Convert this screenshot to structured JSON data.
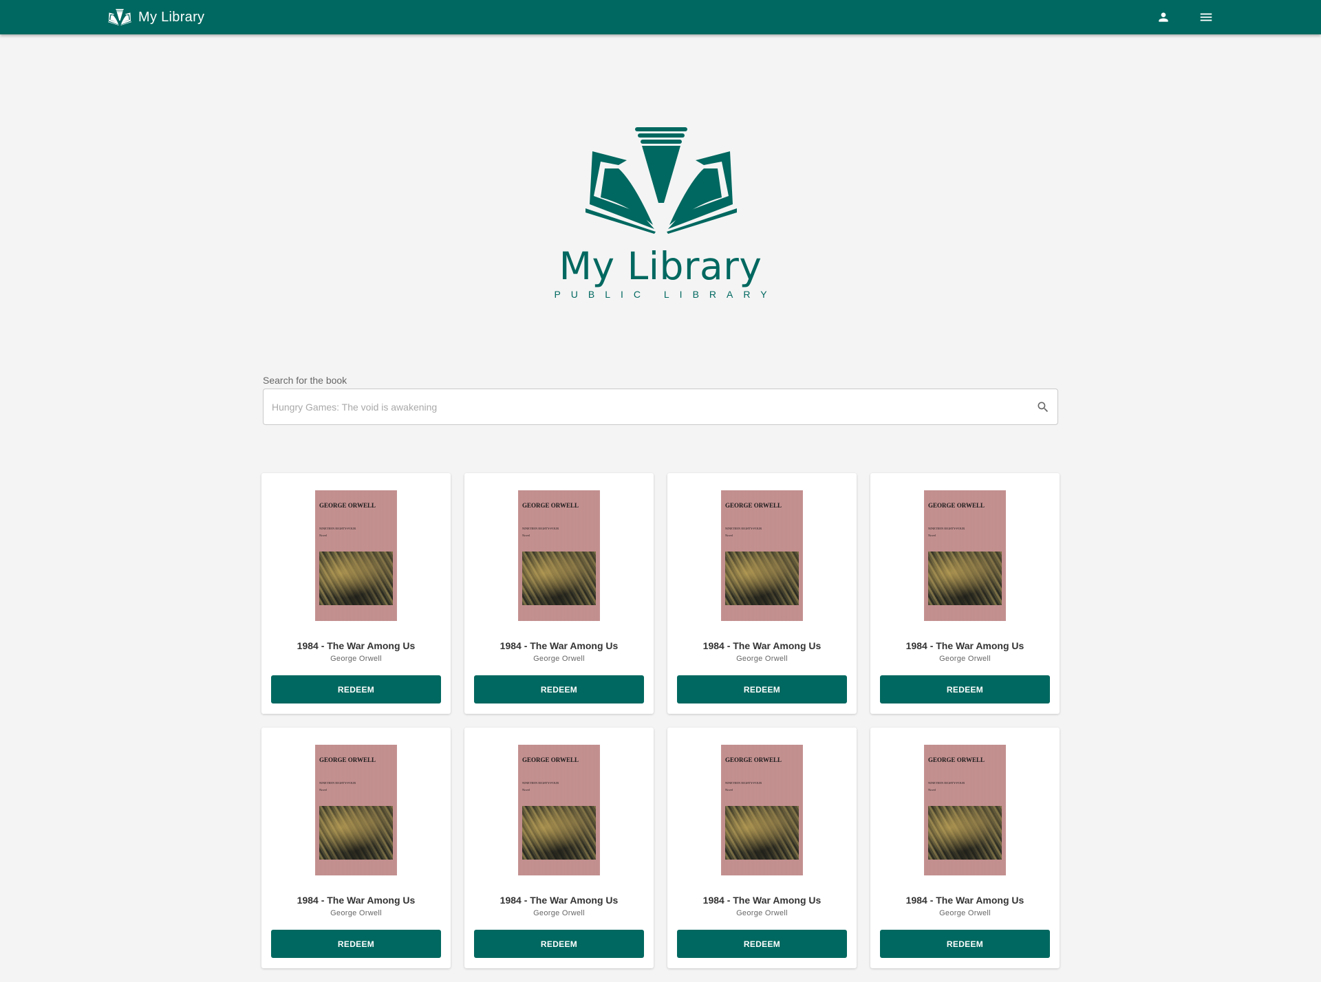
{
  "header": {
    "app_name": "My Library",
    "icons": [
      "book-logo-icon",
      "user-icon",
      "menu-icon"
    ]
  },
  "hero": {
    "title": "My Library",
    "subtitle": "PUBLIC LIBRARY"
  },
  "search": {
    "label": "Search for the book",
    "placeholder": "Hungry Games: The void is awakening",
    "value": ""
  },
  "colors": {
    "primary": "#006860",
    "background": "#f4f4f4",
    "cover": "#c48e8e"
  },
  "books": [
    {
      "title": "1984 - The War Among Us",
      "author": "George Orwell",
      "action": "REDEEM",
      "cover": {
        "author": "GEORGE ORWELL",
        "title": "NINETEEN EIGHTY-FOUR",
        "kind": "Novel"
      }
    },
    {
      "title": "1984 - The War Among Us",
      "author": "George Orwell",
      "action": "REDEEM",
      "cover": {
        "author": "GEORGE ORWELL",
        "title": "NINETEEN EIGHTY-FOUR",
        "kind": "Novel"
      }
    },
    {
      "title": "1984 - The War Among Us",
      "author": "George Orwell",
      "action": "REDEEM",
      "cover": {
        "author": "GEORGE ORWELL",
        "title": "NINETEEN EIGHTY-FOUR",
        "kind": "Novel"
      }
    },
    {
      "title": "1984 - The War Among Us",
      "author": "George Orwell",
      "action": "REDEEM",
      "cover": {
        "author": "GEORGE ORWELL",
        "title": "NINETEEN EIGHTY-FOUR",
        "kind": "Novel"
      }
    },
    {
      "title": "1984 - The War Among Us",
      "author": "George Orwell",
      "action": "REDEEM",
      "cover": {
        "author": "GEORGE ORWELL",
        "title": "NINETEEN EIGHTY-FOUR",
        "kind": "Novel"
      }
    },
    {
      "title": "1984 - The War Among Us",
      "author": "George Orwell",
      "action": "REDEEM",
      "cover": {
        "author": "GEORGE ORWELL",
        "title": "NINETEEN EIGHTY-FOUR",
        "kind": "Novel"
      }
    },
    {
      "title": "1984 - The War Among Us",
      "author": "George Orwell",
      "action": "REDEEM",
      "cover": {
        "author": "GEORGE ORWELL",
        "title": "NINETEEN EIGHTY-FOUR",
        "kind": "Novel"
      }
    },
    {
      "title": "1984 - The War Among Us",
      "author": "George Orwell",
      "action": "REDEEM",
      "cover": {
        "author": "GEORGE ORWELL",
        "title": "NINETEEN EIGHTY-FOUR",
        "kind": "Novel"
      }
    }
  ]
}
